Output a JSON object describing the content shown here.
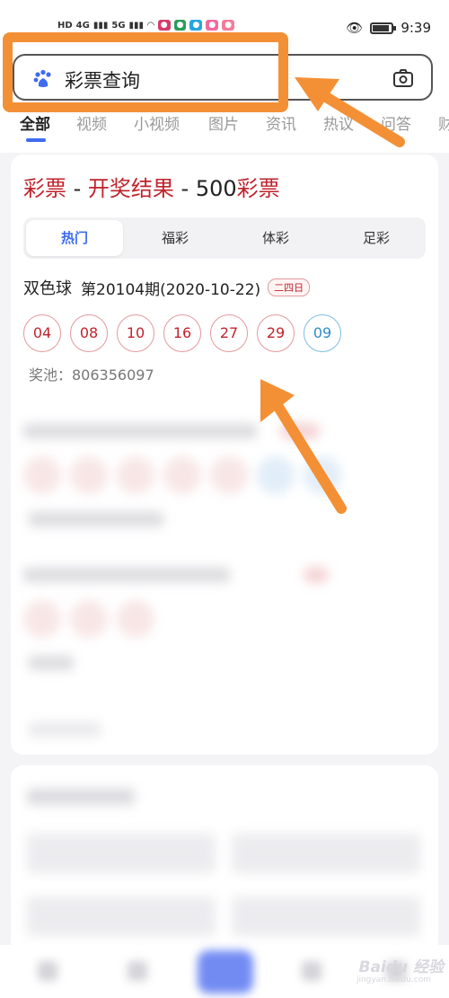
{
  "status_bar": {
    "left_items": [
      "HD",
      "4G",
      "5G"
    ],
    "time": "9:39"
  },
  "search": {
    "query": "彩票查询"
  },
  "tabs": [
    "全部",
    "视频",
    "小视频",
    "图片",
    "资讯",
    "热议",
    "问答",
    "财"
  ],
  "card": {
    "title_part1": "彩票",
    "title_sep1": " - ",
    "title_part2": "开奖结果",
    "title_sep2": " - 500",
    "title_part3": "彩票",
    "segments": [
      "热门",
      "福彩",
      "体彩",
      "足彩"
    ],
    "lottery": {
      "name": "双色球",
      "issue": "第20104期(2020-10-22)",
      "day_badge": "二四日",
      "red_balls": [
        "04",
        "08",
        "10",
        "16",
        "27",
        "29"
      ],
      "blue_balls": [
        "09"
      ],
      "pool": "奖池：806356097"
    }
  },
  "watermark": {
    "text": "Baidu 经验",
    "sub": "jingyan.baidu.com"
  },
  "colors": {
    "accent_blue": "#3e6bef",
    "red": "#c0232b",
    "highlight_orange": "#f39036"
  }
}
